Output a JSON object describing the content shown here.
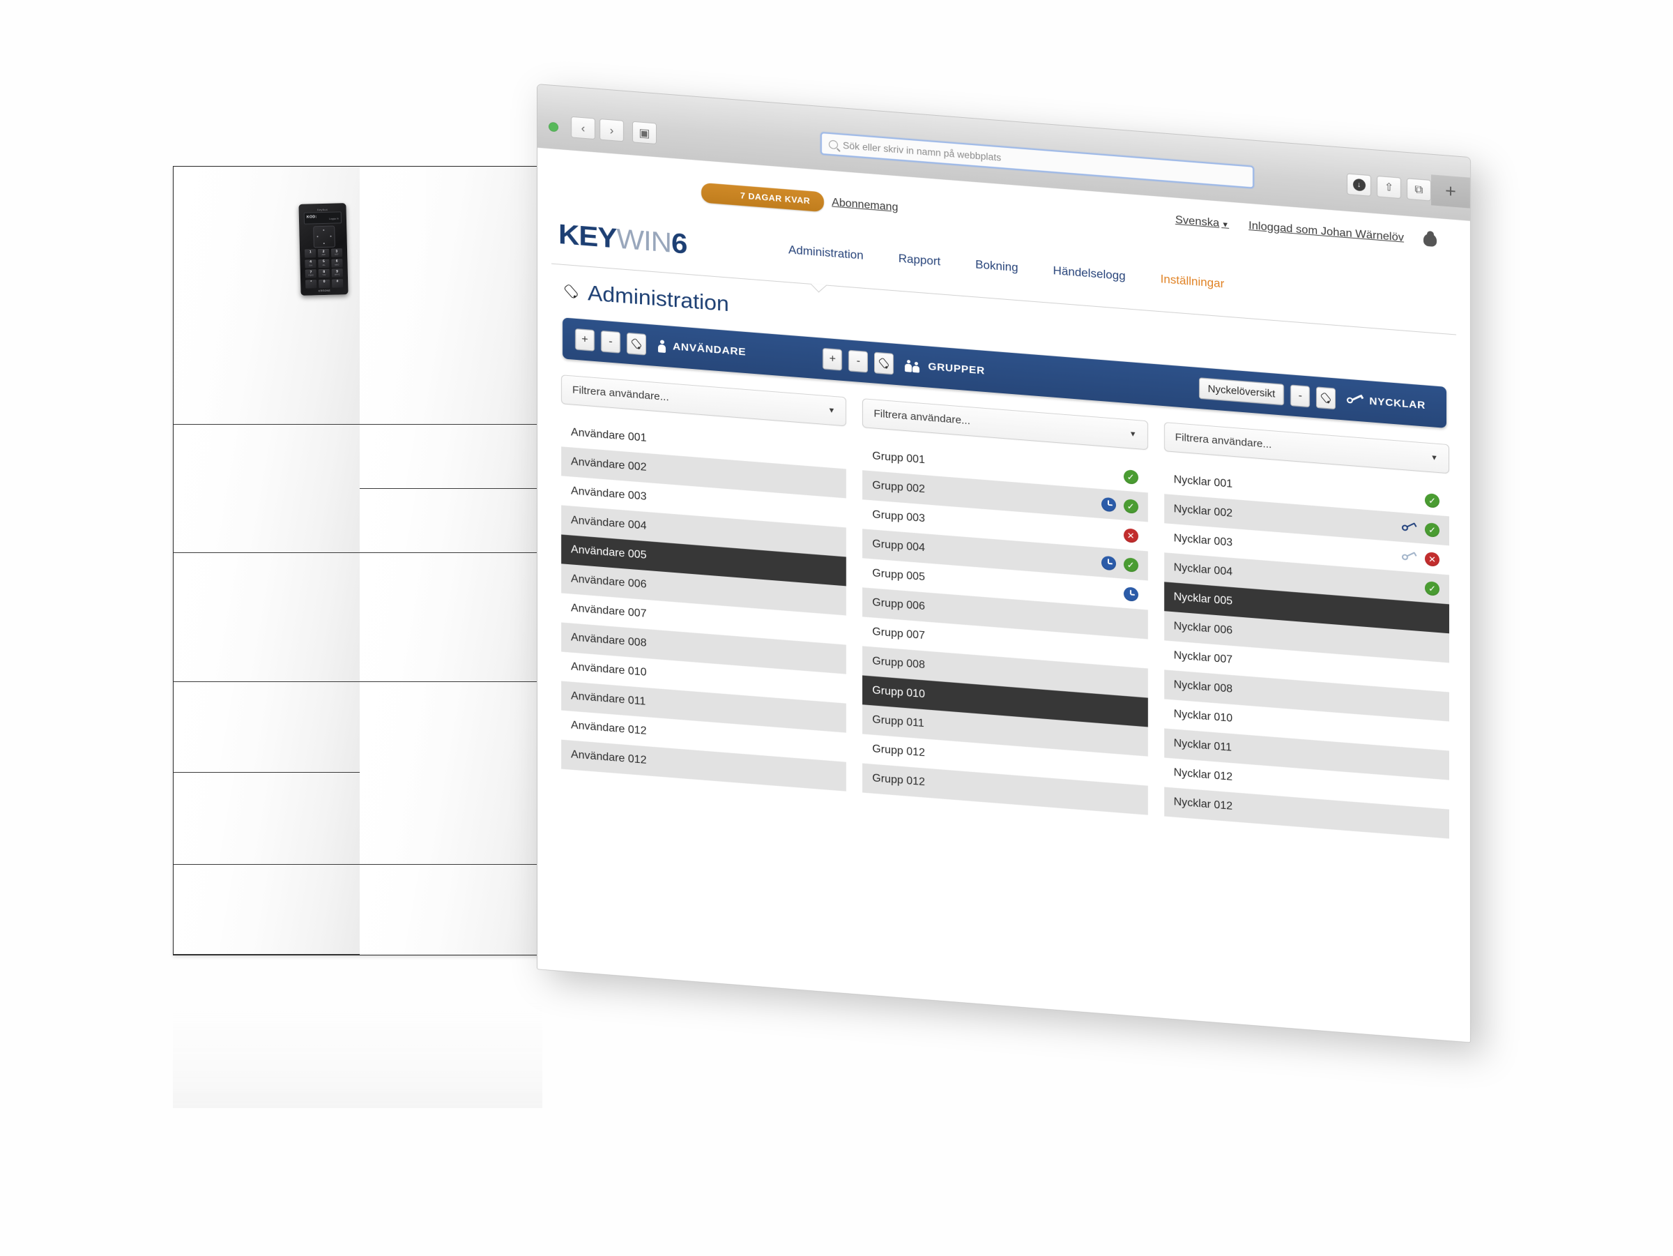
{
  "browser": {
    "url_placeholder": "Sök eller skriv in namn på webbplats",
    "back_icon": "‹",
    "forward_icon": "›",
    "sidebar_icon": "▣",
    "download_icon": "↓",
    "share_icon": "⇧",
    "tabs_icon": "⧉",
    "newtab_icon": "+"
  },
  "topbar": {
    "trial_badge": "7 DAGAR KVAR",
    "subscription_link": "Abonnemang",
    "language": "Svenska",
    "language_caret": "▼",
    "logged_in_as": "Inloggad som Johan Wärnelöv"
  },
  "brand": {
    "logo_part1": "KEY",
    "logo_part2": "WIN",
    "logo_part3": "6"
  },
  "nav": {
    "items": [
      {
        "label": "Administration",
        "active": false
      },
      {
        "label": "Rapport",
        "active": false
      },
      {
        "label": "Bokning",
        "active": false
      },
      {
        "label": "Händelselogg",
        "active": false
      },
      {
        "label": "Inställningar",
        "active": true
      }
    ]
  },
  "page": {
    "title": "Administration"
  },
  "toolbar": {
    "groups": [
      {
        "label": "ANVÄNDARE",
        "icon": "user-icon",
        "buttons": [
          {
            "label": "+",
            "name": "add-user-button"
          },
          {
            "label": "-",
            "name": "remove-user-button"
          },
          {
            "label": "",
            "name": "edit-user-button",
            "icon": "pencil-icon"
          }
        ]
      },
      {
        "label": "GRUPPER",
        "icon": "group-icon",
        "buttons": [
          {
            "label": "+",
            "name": "add-group-button"
          },
          {
            "label": "-",
            "name": "remove-group-button"
          },
          {
            "label": "",
            "name": "edit-group-button",
            "icon": "pencil-icon"
          }
        ]
      },
      {
        "label": "NYCKLAR",
        "icon": "key-icon",
        "overview_button": "Nyckelöversikt",
        "buttons": [
          {
            "label": "-",
            "name": "remove-key-button"
          },
          {
            "label": "",
            "name": "edit-key-button",
            "icon": "pencil-icon"
          }
        ]
      }
    ]
  },
  "columns": [
    {
      "key": "users",
      "filter_placeholder": "Filtrera användare...",
      "rows": [
        {
          "label": "Användare 001",
          "selected": false,
          "badges": []
        },
        {
          "label": "Användare 002",
          "selected": false,
          "badges": []
        },
        {
          "label": "Användare 003",
          "selected": false,
          "badges": []
        },
        {
          "label": "Användare 004",
          "selected": false,
          "badges": []
        },
        {
          "label": "Användare 005",
          "selected": true,
          "badges": []
        },
        {
          "label": "Användare 006",
          "selected": false,
          "badges": []
        },
        {
          "label": "Användare 007",
          "selected": false,
          "badges": []
        },
        {
          "label": "Användare 008",
          "selected": false,
          "badges": []
        },
        {
          "label": "Användare 010",
          "selected": false,
          "badges": []
        },
        {
          "label": "Användare 011",
          "selected": false,
          "badges": []
        },
        {
          "label": "Användare 012",
          "selected": false,
          "badges": []
        },
        {
          "label": "Användare 012",
          "selected": false,
          "badges": []
        }
      ]
    },
    {
      "key": "groups",
      "filter_placeholder": "Filtrera användare...",
      "rows": [
        {
          "label": "Grupp 001",
          "selected": false,
          "badges": [
            "check"
          ]
        },
        {
          "label": "Grupp 002",
          "selected": false,
          "badges": [
            "clock",
            "check"
          ]
        },
        {
          "label": "Grupp 003",
          "selected": false,
          "badges": [
            "cross"
          ]
        },
        {
          "label": "Grupp 004",
          "selected": false,
          "badges": [
            "clock",
            "check"
          ]
        },
        {
          "label": "Grupp 005",
          "selected": false,
          "badges": [
            "clock"
          ]
        },
        {
          "label": "Grupp 006",
          "selected": false,
          "badges": []
        },
        {
          "label": "Grupp 007",
          "selected": false,
          "badges": []
        },
        {
          "label": "Grupp 008",
          "selected": false,
          "badges": []
        },
        {
          "label": "Grupp 010",
          "selected": true,
          "badges": []
        },
        {
          "label": "Grupp 011",
          "selected": false,
          "badges": []
        },
        {
          "label": "Grupp 012",
          "selected": false,
          "badges": []
        },
        {
          "label": "Grupp 012",
          "selected": false,
          "badges": []
        }
      ]
    },
    {
      "key": "keys",
      "filter_placeholder": "Filtrera användare...",
      "rows": [
        {
          "label": "Nycklar 001",
          "selected": false,
          "badges": [
            "check"
          ]
        },
        {
          "label": "Nycklar 002",
          "selected": false,
          "badges": [
            "key-dark",
            "check"
          ]
        },
        {
          "label": "Nycklar 003",
          "selected": false,
          "badges": [
            "key-light",
            "cross"
          ]
        },
        {
          "label": "Nycklar 004",
          "selected": false,
          "badges": [
            "check"
          ]
        },
        {
          "label": "Nycklar 005",
          "selected": true,
          "badges": []
        },
        {
          "label": "Nycklar 006",
          "selected": false,
          "badges": []
        },
        {
          "label": "Nycklar 007",
          "selected": false,
          "badges": []
        },
        {
          "label": "Nycklar 008",
          "selected": false,
          "badges": []
        },
        {
          "label": "Nycklar 010",
          "selected": false,
          "badges": []
        },
        {
          "label": "Nycklar 011",
          "selected": false,
          "badges": []
        },
        {
          "label": "Nycklar 012",
          "selected": false,
          "badges": []
        },
        {
          "label": "Nycklar 012",
          "selected": false,
          "badges": []
        }
      ]
    }
  ],
  "cabinet": {
    "keypad": {
      "brand_top": "Keybox",
      "lcd_text": "KOD:",
      "lcd_soft": "Logga in",
      "brand_bottom": "CREONE",
      "keys": [
        {
          "num": "1",
          "sub": ""
        },
        {
          "num": "2",
          "sub": "ABC"
        },
        {
          "num": "3",
          "sub": "DEF"
        },
        {
          "num": "4",
          "sub": "GHI"
        },
        {
          "num": "5",
          "sub": "JKL"
        },
        {
          "num": "6",
          "sub": "MNO"
        },
        {
          "num": "7",
          "sub": "PQRS"
        },
        {
          "num": "8",
          "sub": "TUV"
        },
        {
          "num": "9",
          "sub": "WXYZ"
        },
        {
          "num": "*",
          "sub": ""
        },
        {
          "num": "0",
          "sub": ""
        },
        {
          "num": "#",
          "sub": ""
        }
      ]
    }
  },
  "colors": {
    "brand_blue": "#1d3f73",
    "toolbar_blue": "#2d5189",
    "accent_orange": "#e08224",
    "trial_orange": "#c07d1d",
    "ok_green": "#4a9c32",
    "error_red": "#c22d2d",
    "clock_blue": "#2b5ba8",
    "selected_row": "#373737"
  }
}
